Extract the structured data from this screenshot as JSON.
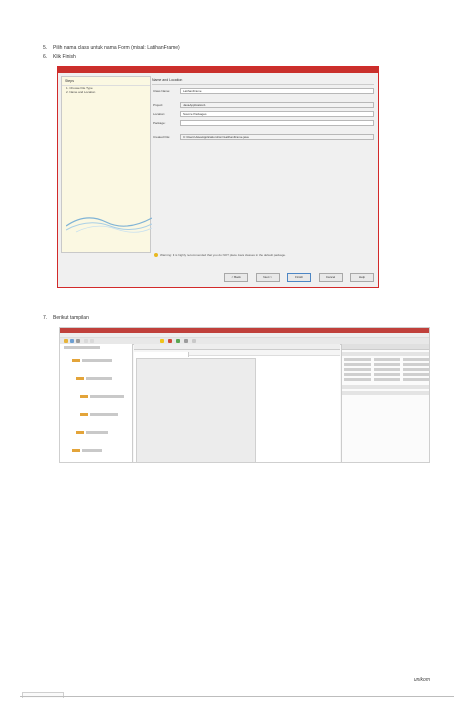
{
  "steps": [
    {
      "num": "5.",
      "text": "Pilih nama class untuk nama Form (misal: LatihanFrame)"
    },
    {
      "num": "6.",
      "text": "Klik Finish"
    },
    {
      "num": "7.",
      "text": "Berikut tampilan"
    }
  ],
  "wizard": {
    "left_header": "Steps",
    "left_items": [
      "1. Choose File Type",
      "2. Name and Location"
    ],
    "right_header": "Name and Location",
    "fields": [
      {
        "label": "Class Name:",
        "value": "LatihanFrame"
      },
      {
        "label": "Project:",
        "value": "JavaApplication1"
      },
      {
        "label": "Location:",
        "value": "Source Packages"
      },
      {
        "label": "Package:",
        "value": ""
      },
      {
        "label": "Created File:",
        "value": "C:\\Users\\JavaApplication1\\src\\LatihanFrame.java"
      }
    ],
    "warning": "Warning: It is highly recommended that you do NOT place Java classes in the default package.",
    "buttons": {
      "back": "< Back",
      "next": "Next >",
      "finish": "Finish",
      "cancel": "Cancel",
      "help": "Help"
    }
  },
  "page_mark": "unikom"
}
